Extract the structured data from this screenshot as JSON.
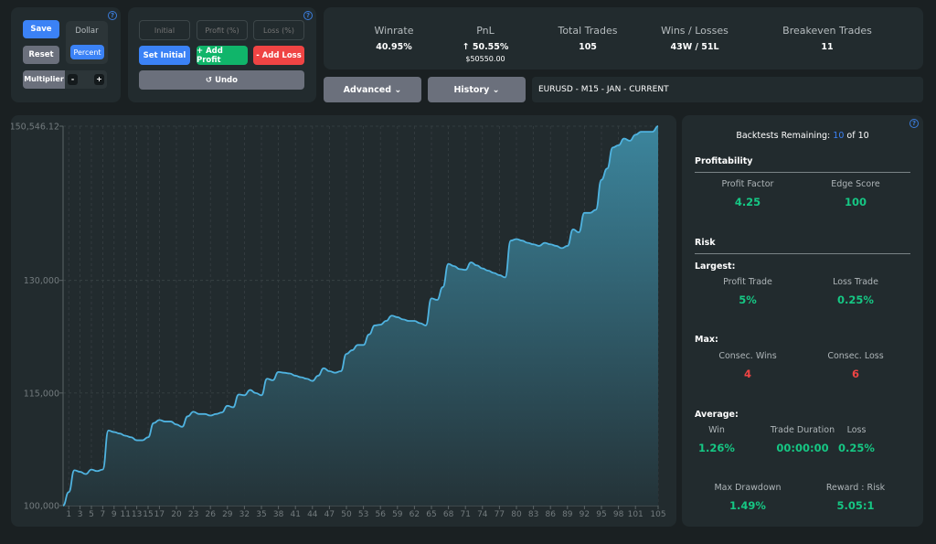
{
  "controls": {
    "save_label": "Save",
    "reset_label": "Reset",
    "mode_options": [
      "Dollar",
      "Percent"
    ],
    "mode_selected": "Percent",
    "multiplier_label": "Multiplier",
    "minus_label": "-",
    "plus_label": "+",
    "help_icon": "?"
  },
  "entry": {
    "initial_placeholder": "Initial",
    "profit_placeholder": "Profit (%)",
    "loss_placeholder": "Loss (%)",
    "set_initial_label": "Set Initial",
    "add_profit_label": "+ Add Profit",
    "add_loss_label": "- Add Loss",
    "undo_label": "↺ Undo"
  },
  "summary": {
    "winrate_label": "Winrate",
    "winrate_value": "40.95%",
    "pnl_label": "PnL",
    "pnl_percent": "↑ 50.55%",
    "pnl_amount": "$50550.00",
    "total_trades_label": "Total Trades",
    "total_trades_value": "105",
    "wins_losses_label": "Wins / Losses",
    "wins_losses_value": "43W / 51L",
    "breakeven_label": "Breakeven Trades",
    "breakeven_value": "11"
  },
  "toolbar": {
    "advanced_label": "Advanced ⌄",
    "history_label": "History ⌄",
    "session_name": "EURUSD - M15 - JAN - CURRENT"
  },
  "stats": {
    "backtests_label": "Backtests Remaining:",
    "backtests_remaining": "10",
    "backtests_of": "of 10",
    "profitability_title": "Profitability",
    "profit_factor_label": "Profit Factor",
    "profit_factor_value": "4.25",
    "edge_score_label": "Edge Score",
    "edge_score_value": "100",
    "risk_title": "Risk",
    "largest_title": "Largest:",
    "largest_profit_label": "Profit Trade",
    "largest_profit_value": "5%",
    "largest_loss_label": "Loss Trade",
    "largest_loss_value": "0.25%",
    "max_title": "Max:",
    "consec_wins_label": "Consec. Wins",
    "consec_wins_value": "4",
    "consec_loss_label": "Consec. Loss",
    "consec_loss_value": "6",
    "average_title": "Average:",
    "avg_win_label": "Win",
    "avg_win_value": "1.26%",
    "avg_duration_label": "Trade Duration",
    "avg_duration_value": "00:00:00",
    "avg_loss_label": "Loss",
    "avg_loss_value": "0.25%",
    "max_drawdown_label": "Max Drawdown",
    "max_drawdown_value": "1.49%",
    "reward_risk_label": "Reward : Risk",
    "reward_risk_value": "5.05:1"
  },
  "colors": {
    "accent_blue": "#3b82f6",
    "profit_green": "#16c784",
    "loss_red": "#ef4444",
    "line_color": "#4fb3e0"
  },
  "chart_data": {
    "type": "area",
    "title": "",
    "xlabel": "",
    "ylabel": "",
    "ylim": [
      100000,
      150546.12
    ],
    "xlim": [
      0,
      105
    ],
    "yticks": [
      100000,
      115000,
      130000,
      150546.12
    ],
    "ytick_labels": [
      "100,000",
      "115,000",
      "130,000",
      "150,546.12"
    ],
    "xtick_labels": [
      "1",
      "3",
      "5",
      "7",
      "9",
      "11",
      "13",
      "15",
      "17",
      "20",
      "23",
      "26",
      "29",
      "32",
      "35",
      "38",
      "41",
      "44",
      "47",
      "50",
      "53",
      "56",
      "59",
      "62",
      "65",
      "68",
      "71",
      "74",
      "77",
      "80",
      "83",
      "86",
      "89",
      "92",
      "95",
      "98",
      "101",
      "105"
    ],
    "grid": true,
    "x": [
      0,
      1,
      2,
      3,
      4,
      5,
      6,
      7,
      8,
      9,
      10,
      11,
      12,
      13,
      14,
      15,
      16,
      17,
      18,
      19,
      20,
      21,
      22,
      23,
      24,
      25,
      26,
      27,
      28,
      29,
      30,
      31,
      32,
      33,
      34,
      35,
      36,
      37,
      38,
      39,
      40,
      41,
      42,
      43,
      44,
      45,
      46,
      47,
      48,
      49,
      50,
      51,
      52,
      53,
      54,
      55,
      56,
      57,
      58,
      59,
      60,
      61,
      62,
      63,
      64,
      65,
      66,
      67,
      68,
      69,
      70,
      71,
      72,
      73,
      74,
      75,
      76,
      77,
      78,
      79,
      80,
      81,
      82,
      83,
      84,
      85,
      86,
      87,
      88,
      89,
      90,
      91,
      92,
      93,
      94,
      95,
      96,
      97,
      98,
      99,
      100,
      101,
      102,
      103,
      104,
      105
    ],
    "values": [
      100000,
      101800,
      104700,
      104500,
      104200,
      104800,
      104600,
      104800,
      110000,
      109800,
      109600,
      109300,
      109100,
      108700,
      108700,
      109100,
      111000,
      111400,
      111200,
      111200,
      110800,
      110500,
      111900,
      112500,
      112200,
      112200,
      112000,
      112200,
      112400,
      113300,
      113100,
      114800,
      114700,
      115400,
      115000,
      114700,
      116900,
      116700,
      117800,
      117700,
      117600,
      117300,
      117100,
      116900,
      116600,
      117300,
      118300,
      117900,
      117700,
      117900,
      120200,
      120700,
      121400,
      121400,
      122800,
      124000,
      124100,
      124600,
      125300,
      125100,
      124800,
      124600,
      124600,
      124300,
      124000,
      127600,
      127400,
      129100,
      132200,
      131900,
      131500,
      131400,
      132400,
      132000,
      131600,
      131300,
      131000,
      130700,
      130400,
      135300,
      135500,
      135300,
      135000,
      134800,
      134600,
      135000,
      134800,
      134600,
      134300,
      134600,
      136800,
      136400,
      139000,
      139000,
      139400,
      143400,
      144900,
      147700,
      148000,
      148900,
      148600,
      149400,
      149800,
      149800,
      149800,
      150546.12
    ]
  }
}
